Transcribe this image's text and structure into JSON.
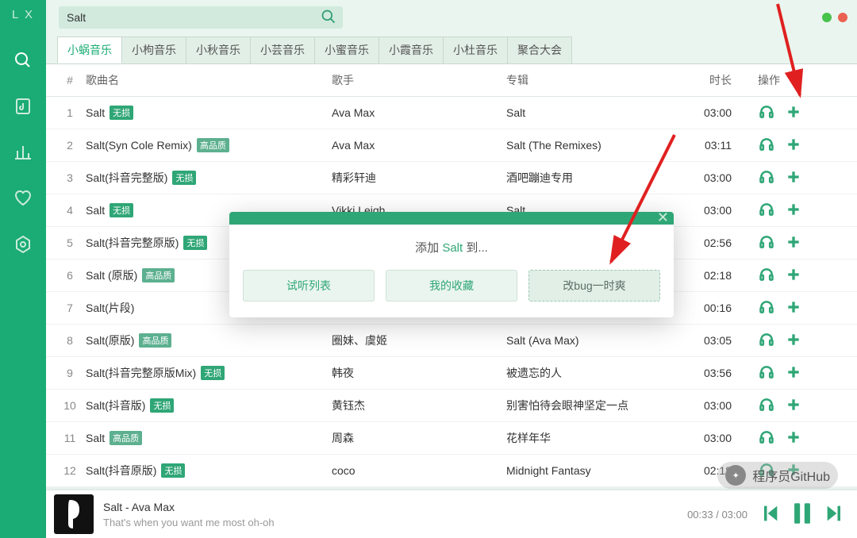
{
  "logo": "L X",
  "search": {
    "value": "Salt"
  },
  "window_controls": {
    "minimize": "minimize",
    "close": "close"
  },
  "tabs": [
    {
      "label": "小蜗音乐",
      "active": true
    },
    {
      "label": "小枸音乐"
    },
    {
      "label": "小秋音乐"
    },
    {
      "label": "小芸音乐"
    },
    {
      "label": "小蜜音乐"
    },
    {
      "label": "小霞音乐"
    },
    {
      "label": "小杜音乐"
    },
    {
      "label": "聚合大会"
    }
  ],
  "columns": {
    "idx": "#",
    "name": "歌曲名",
    "artist": "歌手",
    "album": "专辑",
    "duration": "时长",
    "ops": "操作"
  },
  "quality_labels": {
    "lossless": "无损",
    "hq": "高品质"
  },
  "rows": [
    {
      "idx": "1",
      "name": "Salt",
      "quality": "lossless",
      "artist": "Ava Max",
      "album": "Salt",
      "duration": "03:00"
    },
    {
      "idx": "2",
      "name": "Salt(Syn Cole Remix)",
      "quality": "hq",
      "artist": "Ava Max",
      "album": "Salt (The Remixes)",
      "duration": "03:11"
    },
    {
      "idx": "3",
      "name": "Salt(抖音完整版)",
      "quality": "lossless",
      "artist": "精彩轩迪",
      "album": "酒吧蹦迪专用",
      "duration": "03:00"
    },
    {
      "idx": "4",
      "name": "Salt",
      "quality": "lossless",
      "artist": "Vikki Leigh",
      "album": "Salt",
      "duration": "03:00"
    },
    {
      "idx": "5",
      "name": "Salt(抖音完整原版)",
      "quality": "lossless",
      "artist": "",
      "album": "",
      "duration": "02:56"
    },
    {
      "idx": "6",
      "name": "Salt (原版)",
      "quality": "hq",
      "artist": "",
      "album": "",
      "duration": "02:18"
    },
    {
      "idx": "7",
      "name": "Salt(片段)",
      "quality": "",
      "artist": "",
      "album": "",
      "duration": "00:16"
    },
    {
      "idx": "8",
      "name": "Salt(原版)",
      "quality": "hq",
      "artist": "圈妹、虞姬",
      "album": "Salt (Ava Max)",
      "duration": "03:05"
    },
    {
      "idx": "9",
      "name": "Salt(抖音完整原版Mix)",
      "quality": "lossless",
      "artist": "韩夜",
      "album": "被遗忘的人",
      "duration": "03:56"
    },
    {
      "idx": "10",
      "name": "Salt(抖音版)",
      "quality": "lossless",
      "artist": "黄钰杰",
      "album": "别害怕待会眼神坚定一点",
      "duration": "03:00"
    },
    {
      "idx": "11",
      "name": "Salt",
      "quality": "hq",
      "artist": "周森",
      "album": "花样年华",
      "duration": "03:00"
    },
    {
      "idx": "12",
      "name": "Salt(抖音原版)",
      "quality": "lossless",
      "artist": "coco",
      "album": "Midnight Fantasy",
      "duration": "02:18"
    }
  ],
  "modal": {
    "title_prefix": "添加 ",
    "title_highlight": "Salt",
    "title_suffix": " 到...",
    "buttons": {
      "audition": "试听列表",
      "favorites": "我的收藏",
      "custom": "改bug一时爽"
    }
  },
  "player": {
    "title": "Salt - Ava Max",
    "lyric": "That's when you want me most oh-oh",
    "elapsed": "00:33",
    "sep": " / ",
    "total": "03:00"
  },
  "watermark": "程序员GitHub"
}
